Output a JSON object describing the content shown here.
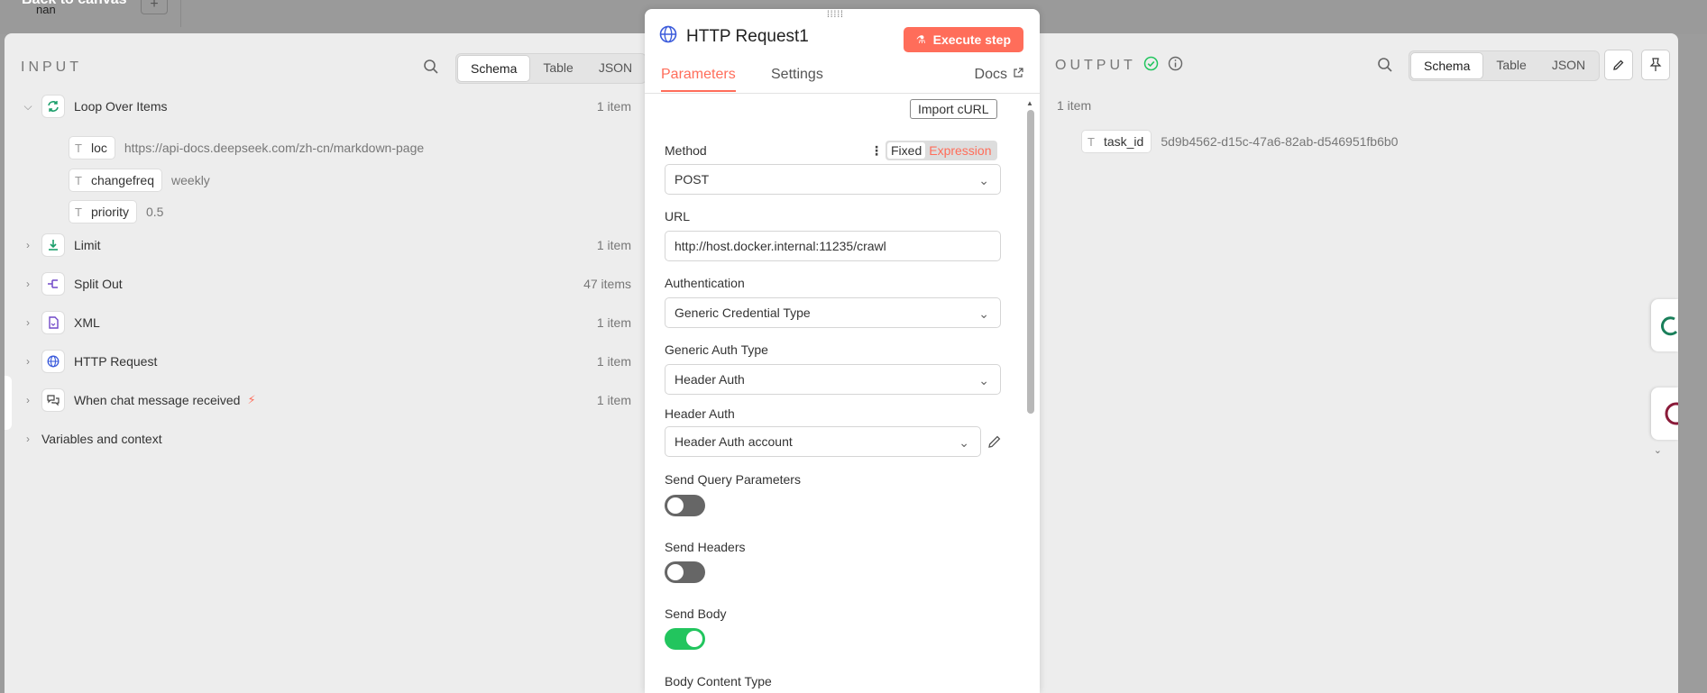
{
  "backdrop": {
    "title": "Back to canvas",
    "subtitle": "nan",
    "plus": "+"
  },
  "input": {
    "label": "INPUT",
    "views": [
      "Schema",
      "Table",
      "JSON"
    ],
    "active_view": "Schema",
    "nodes": [
      {
        "name": "Loop Over Items",
        "count": "1 item",
        "icon": "loop-icon",
        "expanded": true,
        "fields": [
          {
            "key": "loc",
            "value": "https://api-docs.deepseek.com/zh-cn/markdown-page"
          },
          {
            "key": "changefreq",
            "value": "weekly"
          },
          {
            "key": "priority",
            "value": "0.5"
          }
        ]
      },
      {
        "name": "Limit",
        "count": "1 item",
        "icon": "limit-icon"
      },
      {
        "name": "Split Out",
        "count": "47 items",
        "icon": "split-out-icon"
      },
      {
        "name": "XML",
        "count": "1 item",
        "icon": "xml-file-icon"
      },
      {
        "name": "HTTP Request",
        "count": "1 item",
        "icon": "globe-icon"
      },
      {
        "name": "When chat message received",
        "count": "1 item",
        "icon": "chat-icon",
        "badge": "lightning-icon"
      }
    ],
    "variables": "Variables and context"
  },
  "node": {
    "title": "HTTP Request1",
    "execute_label": "Execute step",
    "tabs": [
      "Parameters",
      "Settings"
    ],
    "active_tab": "Parameters",
    "docs_label": "Docs",
    "import_curl": "Import cURL",
    "method": {
      "label": "Method",
      "value": "POST",
      "fixed": "Fixed",
      "expression": "Expression"
    },
    "url": {
      "label": "URL",
      "value": "http://host.docker.internal:11235/crawl"
    },
    "authentication": {
      "label": "Authentication",
      "value": "Generic Credential Type"
    },
    "generic_auth": {
      "label": "Generic Auth Type",
      "value": "Header Auth"
    },
    "header_auth": {
      "label": "Header Auth",
      "value": "Header Auth account"
    },
    "send_query": {
      "label": "Send Query Parameters",
      "on": false
    },
    "send_headers": {
      "label": "Send Headers",
      "on": false
    },
    "send_body": {
      "label": "Send Body",
      "on": true
    },
    "body_content_type": {
      "label": "Body Content Type"
    }
  },
  "output": {
    "label": "OUTPUT",
    "views": [
      "Schema",
      "Table",
      "JSON"
    ],
    "active_view": "Schema",
    "count": "1 item",
    "field": {
      "key": "task_id",
      "value": "5d9b4562-d15c-47a6-82ab-d546951fb6b0"
    }
  },
  "colors": {
    "accent": "#ff6d5a",
    "success": "#22c55e",
    "globe": "#3b5bdb"
  }
}
